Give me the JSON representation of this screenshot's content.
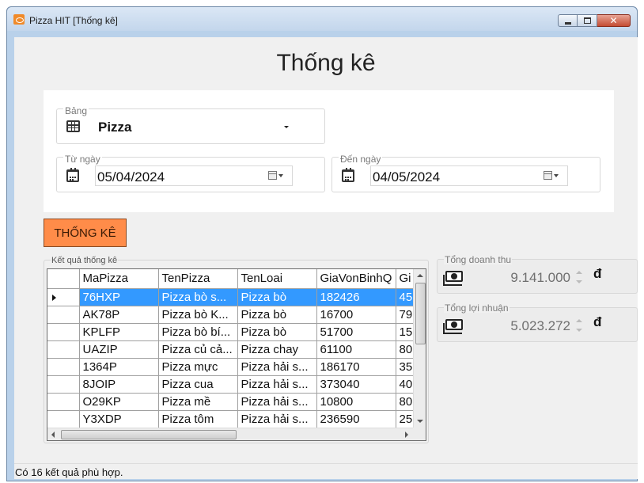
{
  "window": {
    "title": "Pizza HIT [Thống kê]",
    "controls": {
      "minimize": "minimize-icon",
      "maximize": "maximize-icon",
      "close": "close-icon"
    }
  },
  "page": {
    "title": "Thống kê"
  },
  "filters": {
    "table": {
      "label": "Bảng",
      "value": "Pizza",
      "icon": "table-icon"
    },
    "from_date": {
      "label": "Từ ngày",
      "value": "05/04/2024",
      "icon": "calendar-icon"
    },
    "to_date": {
      "label": "Đến ngày",
      "value": "04/05/2024",
      "icon": "calendar-icon"
    }
  },
  "actions": {
    "stat_button": "THỐNG KÊ"
  },
  "results": {
    "label": "Kết quả thống kê",
    "columns": [
      "MaPizza",
      "TenPizza",
      "TenLoai",
      "GiaVonBinhQ",
      "Gi"
    ],
    "rows": [
      [
        "76HXP",
        "Pizza bò s...",
        "Pizza bò",
        "182426",
        "45"
      ],
      [
        "AK78P",
        "Pizza bò K...",
        "Pizza bò",
        "16700",
        "79"
      ],
      [
        "KPLFP",
        "Pizza bò bí...",
        "Pizza bò",
        "51700",
        "15"
      ],
      [
        "UAZIP",
        "Pizza củ cả...",
        "Pizza chay",
        "61100",
        "80"
      ],
      [
        "1364P",
        "Pizza mực",
        "Pizza hải s...",
        "186170",
        "35"
      ],
      [
        "8JOIP",
        "Pizza cua",
        "Pizza hải s...",
        "373040",
        "40"
      ],
      [
        "O29KP",
        "Pizza mề",
        "Pizza hải s...",
        "10800",
        "80"
      ],
      [
        "Y3XDP",
        "Pizza tôm",
        "Pizza hải s...",
        "236590",
        "25"
      ]
    ],
    "selected_row": 0
  },
  "summary": {
    "revenue": {
      "label": "Tổng doanh thu",
      "value": "9.141.000",
      "currency": "đ",
      "icon": "money-icon"
    },
    "profit": {
      "label": "Tổng lợi nhuận",
      "value": "5.023.272",
      "currency": "đ",
      "icon": "money-icon"
    }
  },
  "status": {
    "text": "Có 16 kết quả phù hợp."
  },
  "colors": {
    "accent_button": "#ff8c49",
    "selection": "#3399ff",
    "window_frame": "#b9d1ea"
  }
}
